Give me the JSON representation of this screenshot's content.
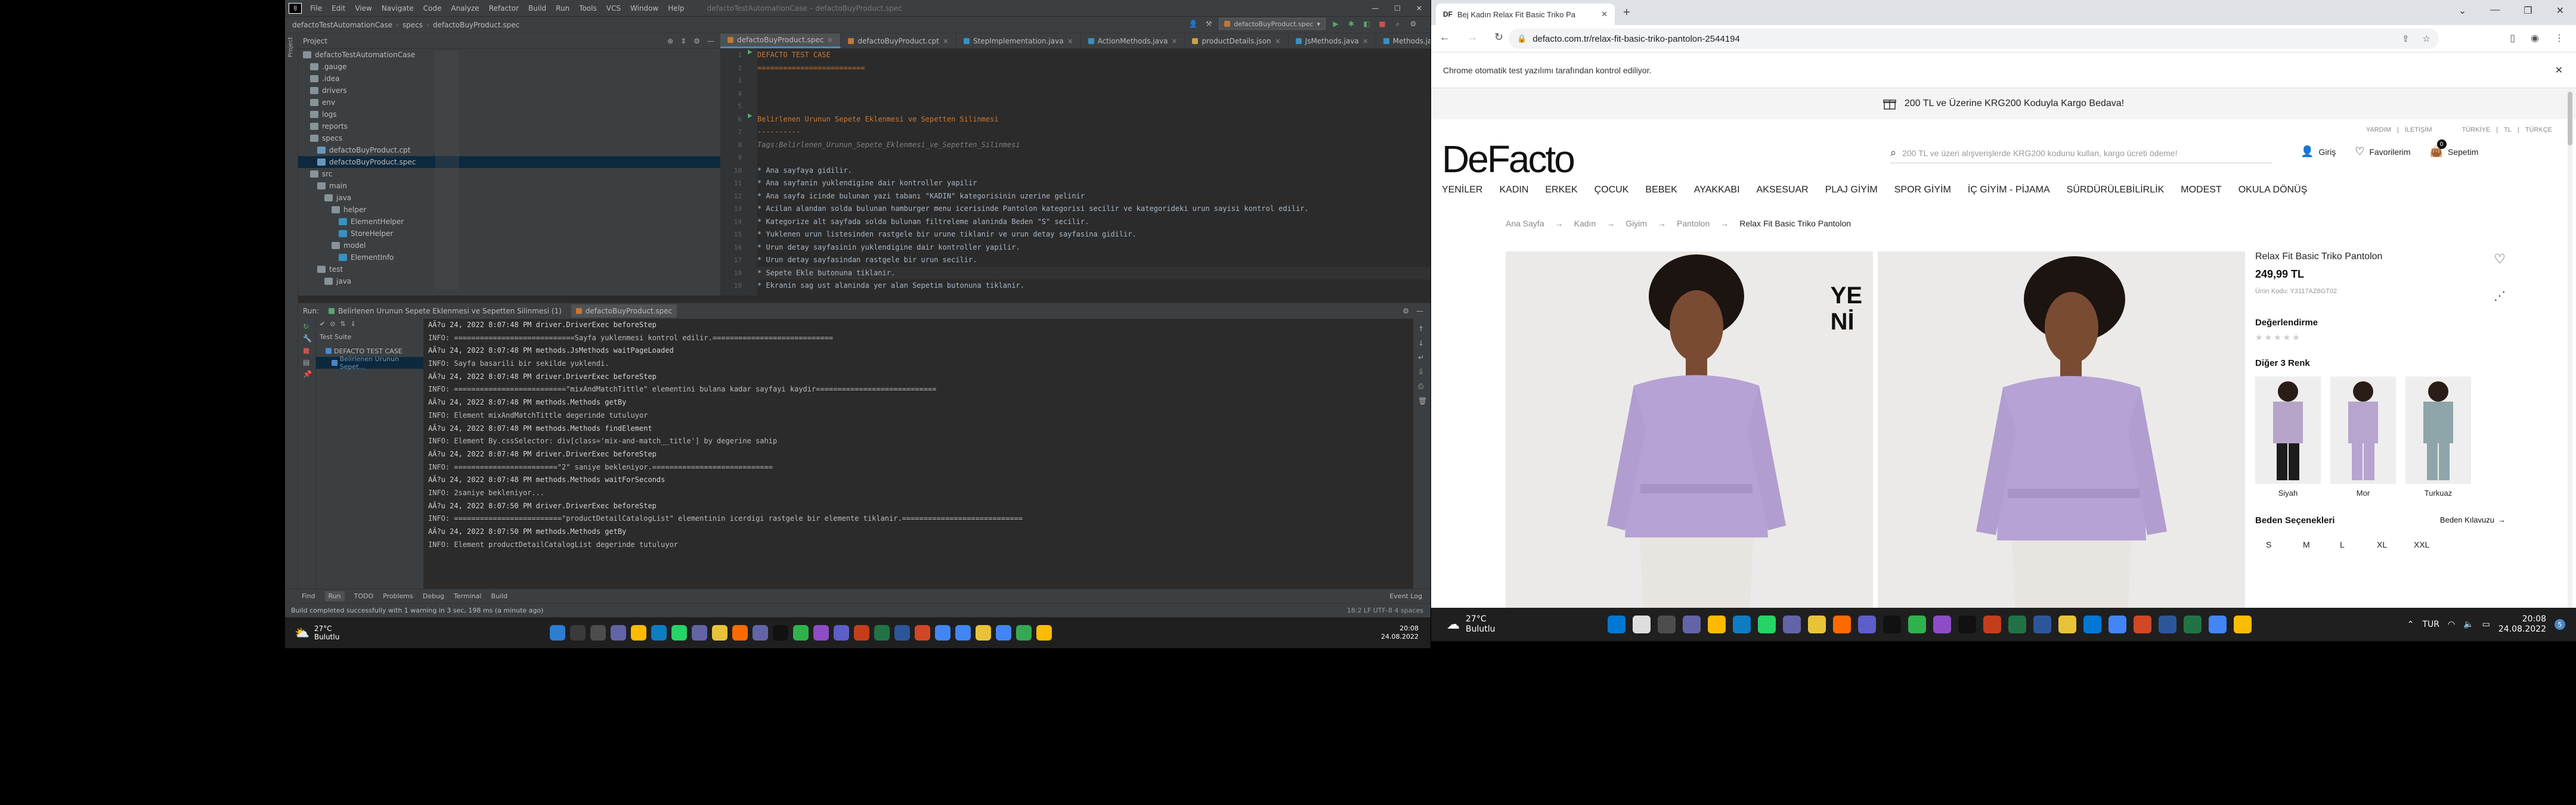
{
  "ide": {
    "window_title": "defactoTestAutomationCase – defactoBuyProduct.spec",
    "menu": [
      "File",
      "Edit",
      "View",
      "Navigate",
      "Code",
      "Analyze",
      "Refactor",
      "Build",
      "Run",
      "Tools",
      "VCS",
      "Window",
      "Help"
    ],
    "breadcrumb": [
      "defactoTestAutomationCase",
      "specs",
      "defactoBuyProduct.spec"
    ],
    "run_config": "defactoBuyProduct.spec",
    "project_label": "Project",
    "project_tree": [
      {
        "label": "defactoTestAutomationCase",
        "indent": 0,
        "color": "#87939a"
      },
      {
        "label": ".gauge",
        "indent": 1,
        "color": "#87939a"
      },
      {
        "label": ".idea",
        "indent": 1,
        "color": "#87939a"
      },
      {
        "label": "drivers",
        "indent": 1,
        "color": "#87939a"
      },
      {
        "label": "env",
        "indent": 1,
        "color": "#87939a"
      },
      {
        "label": "logs",
        "indent": 1,
        "color": "#87939a"
      },
      {
        "label": "reports",
        "indent": 1,
        "color": "#87939a"
      },
      {
        "label": "specs",
        "indent": 1,
        "color": "#87939a"
      },
      {
        "label": "defactoBuyProduct.cpt",
        "indent": 2,
        "color": "#6897bb"
      },
      {
        "label": "defactoBuyProduct.spec",
        "indent": 2,
        "color": "#6897bb"
      },
      {
        "label": "src",
        "indent": 1,
        "color": "#87939a"
      },
      {
        "label": "main",
        "indent": 2,
        "color": "#87939a"
      },
      {
        "label": "java",
        "indent": 3,
        "color": "#87939a"
      },
      {
        "label": "helper",
        "indent": 4,
        "color": "#87939a"
      },
      {
        "label": "ElementHelper",
        "indent": 5,
        "color": "#3592c4"
      },
      {
        "label": "StoreHelper",
        "indent": 5,
        "color": "#3592c4"
      },
      {
        "label": "model",
        "indent": 4,
        "color": "#87939a"
      },
      {
        "label": "ElementInfo",
        "indent": 5,
        "color": "#3592c4"
      },
      {
        "label": "test",
        "indent": 2,
        "color": "#87939a"
      },
      {
        "label": "java",
        "indent": 3,
        "color": "#87939a"
      }
    ],
    "editor_tabs": [
      "defactoBuyProduct.spec",
      "defactoBuyProduct.cpt",
      "StepImplementation.java",
      "ActionMethods.java",
      "productDetails.json",
      "JsMethods.java",
      "Methods.java"
    ],
    "code_lines": [
      {
        "t": "DEFACTO TEST CASE",
        "c": "c-h"
      },
      {
        "t": "=========================",
        "c": "c-h"
      },
      {
        "t": "",
        "c": "c-b"
      },
      {
        "t": "",
        "c": "c-b"
      },
      {
        "t": "",
        "c": "c-b"
      },
      {
        "t": "Belirlenen Urunun Sepete Eklenmesi ve Sepetten Silinmesi",
        "c": "c-u"
      },
      {
        "t": "----------",
        "c": "c-u"
      },
      {
        "t": "Tags:Belirlenen_Urunun_Sepete_Eklenmesi_ve_Sepetten_Silinmesi",
        "c": "c-s"
      },
      {
        "t": "",
        "c": "c-b"
      },
      {
        "t": "* Ana sayfaya gidilir.",
        "c": "c-b"
      },
      {
        "t": "* Ana sayfanin yuklendigine dair kontroller yapilir",
        "c": "c-b"
      },
      {
        "t": "* Ana sayfa icinde bulunan yazi tabanı \"KADIN\" kategorisinin uzerine gelinir",
        "c": "c-b"
      },
      {
        "t": "* Acilan alandan solda bulunan hamburger menu icerisinde Pantolon kategorisi secilir ve kategorideki urun sayisi kontrol edilir.",
        "c": "c-b"
      },
      {
        "t": "* Kategorize alt sayfada solda bulunan filtreleme alaninda Beden \"S\" secilir.",
        "c": "c-b"
      },
      {
        "t": "* Yuklenen urun listesinden rastgele bir urune tiklanir ve urun detay sayfasina gidilir.",
        "c": "c-b"
      },
      {
        "t": "* Urun detay sayfasinin yuklendigine dair kontroller yapilir.",
        "c": "c-b"
      },
      {
        "t": "* Urun detay sayfasindan rastgele bir urun secilir.",
        "c": "c-b"
      },
      {
        "t": "* Sepete Ekle butonuna tiklanir.",
        "c": "c-b"
      },
      {
        "t": "* Ekranin sag ust alaninda yer alan Sepetim butonuna tiklanir.",
        "c": "c-b"
      }
    ],
    "run_label": "Run:",
    "run_tabs": [
      "Belirlenen Urunun Sepete Eklenmesi ve Sepetten Silinmesi (1)",
      "defactoBuyProduct.spec"
    ],
    "test_tree": [
      "Test Suite",
      "DEFACTO TEST CASE",
      "Belirlenen Urunun Sepet..."
    ],
    "console_lines": [
      "AÄ?u 24, 2022 8:07:48 PM driver.DriverExec beforeStep",
      "INFO: ============================Sayfa yuklenmesi kontrol edilir.============================",
      "AÄ?u 24, 2022 8:07:48 PM methods.JsMethods waitPageLoaded",
      "INFO: Sayfa basarili bir sekilde yuklendi.",
      "AÄ?u 24, 2022 8:07:48 PM driver.DriverExec beforeStep",
      "INFO: ==========================\"mixAndMatchTittle\" elementini bulana kadar sayfayi kaydir============================",
      "AÄ?u 24, 2022 8:07:48 PM methods.Methods getBy",
      "INFO: Element mixAndMatchTittle degerinde tutuluyor",
      "AÄ?u 24, 2022 8:07:48 PM methods.Methods findElement",
      "INFO: Element By.cssSelector: div[class='mix-and-match__title'] by degerine sahip",
      "AÄ?u 24, 2022 8:07:48 PM driver.DriverExec beforeStep",
      "INFO: ========================\"2\" saniye bekleniyor.============================",
      "AÄ?u 24, 2022 8:07:48 PM methods.Methods waitForSeconds",
      "INFO: 2saniye bekleniyor...",
      "AÄ?u 24, 2022 8:07:50 PM driver.DriverExec beforeStep",
      "INFO: =========================\"productDetailCatalogList\" elementinin icerdigi rastgele bir elemente tiklanir.============================",
      "AÄ?u 24, 2022 8:07:50 PM methods.Methods getBy",
      "INFO: Element productDetailCatalogList degerinde tutuluyor"
    ],
    "bottom_tabs": [
      "Find",
      "Run",
      "TODO",
      "Problems",
      "Debug",
      "Terminal",
      "Build"
    ],
    "event_log": "Event Log",
    "status_text": "Build completed successfully with 1 warning in 3 sec, 198 ms (a minute ago)",
    "status_right": "18:2   LF   UTF-8   4 spaces"
  },
  "browser": {
    "tab_title": "Bej Kadın Relax Fit Basic Triko Pa",
    "url": "defacto.com.tr/relax-fit-basic-triko-pantolon-2544194",
    "infobar": "Chrome otomatik test yazılımı tarafından kontrol ediliyor.",
    "promo": "200 TL ve Üzerine KRG200 Koduyla Kargo Bedava!",
    "top_links": [
      "YARDIM",
      "İLETİŞİM",
      "TÜRKİYE",
      "TL",
      "TÜRKÇE"
    ],
    "logo": "DeFacto",
    "search_placeholder": "200 TL ve üzeri alışverişlerde KRG200 kodunu kullan, kargo ücreti ödeme!",
    "login": "Giriş",
    "favorites": "Favorilerim",
    "cart": "Sepetim",
    "cart_count": "0",
    "nav": [
      "YENİLER",
      "KADIN",
      "ERKEK",
      "ÇOCUK",
      "BEBEK",
      "AYAKKABI",
      "AKSESUAR",
      "PLAJ GİYİM",
      "SPOR GİYİM",
      "İÇ GİYİM - PİJAMA",
      "SÜRDÜRÜLEBİLİRLİK",
      "MODEST",
      "OKULA DÖNÜŞ"
    ],
    "breadcrumb": [
      "Ana Sayfa",
      "Kadın",
      "Giyim",
      "Pantolon",
      "Relax Fit Basic Triko Pantolon"
    ],
    "badge_line1": "YE",
    "badge_line2": "Nİ",
    "product_name": "Relax Fit Basic Triko Pantolon",
    "price": "249,99 TL",
    "product_code": "Ürün Kodu: Y3117AZ8GT02",
    "rating_title": "Değerlendirme",
    "colors_title": "Diğer 3 Renk",
    "colors": [
      {
        "name": "Siyah",
        "top": "#b7a4c9",
        "bottom": "#1c1c1c"
      },
      {
        "name": "Mor",
        "top": "#b7a4cf",
        "bottom": "#b7a4cf"
      },
      {
        "name": "Turkuaz",
        "top": "#8ea6a9",
        "bottom": "#8ea6a9"
      }
    ],
    "size_title": "Beden Seçenekleri",
    "size_guide": "Beden Kılavuzu",
    "sizes": [
      "S",
      "M",
      "L",
      "XL",
      "XXL"
    ]
  },
  "taskbar_left": {
    "weather_temp": "27°C",
    "weather_desc": "Bulutlu",
    "time": "20:08",
    "date": "24.08.2022"
  },
  "taskbar_right": {
    "weather_temp": "27°C",
    "weather_desc": "Bulutlu",
    "lang": "TUR",
    "time": "20:08",
    "date": "24.08.2022",
    "badge": "5"
  },
  "colors": {
    "ide_bg": "#2b2b2b",
    "ide_panel": "#3c3f41",
    "accent_purple": "#b6a2d4",
    "taskbar": "#1f1f1f"
  }
}
